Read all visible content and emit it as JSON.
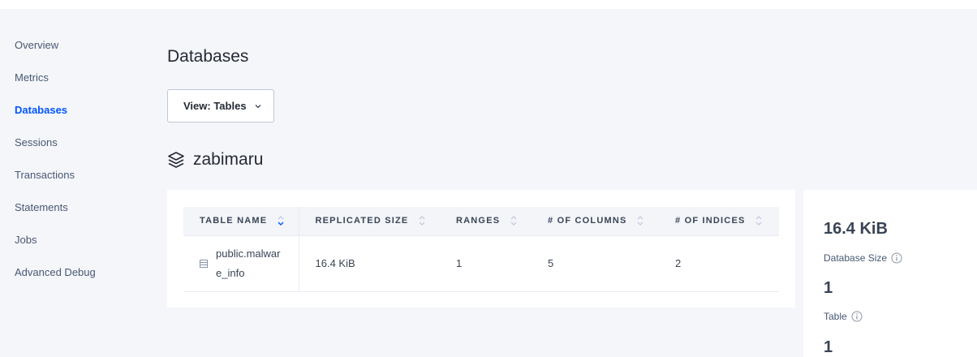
{
  "sidebar": {
    "items": [
      {
        "label": "Overview"
      },
      {
        "label": "Metrics"
      },
      {
        "label": "Databases"
      },
      {
        "label": "Sessions"
      },
      {
        "label": "Transactions"
      },
      {
        "label": "Statements"
      },
      {
        "label": "Jobs"
      },
      {
        "label": "Advanced Debug"
      }
    ],
    "active": "Databases"
  },
  "main": {
    "title": "Databases",
    "view_select": {
      "label": "View: Tables",
      "icon": "chevron-down-icon"
    },
    "database": {
      "name": "zabimaru",
      "icon": "stack-icon"
    }
  },
  "table": {
    "columns": [
      "TABLE NAME",
      "REPLICATED SIZE",
      "RANGES",
      "# OF COLUMNS",
      "# OF INDICES"
    ],
    "sorted_column": "TABLE NAME",
    "rows": [
      {
        "name": "public.malware_info",
        "replicated_size": "16.4 KiB",
        "ranges": "1",
        "columns": "5",
        "indices": "2"
      }
    ]
  },
  "summary": {
    "items": [
      {
        "value": "16.4 KiB",
        "label": "Database Size"
      },
      {
        "value": "1",
        "label": "Table"
      },
      {
        "value": "1",
        "label": ""
      }
    ]
  },
  "colors": {
    "accent": "#0055ff",
    "background": "#f5f6fa",
    "card": "#ffffff"
  }
}
